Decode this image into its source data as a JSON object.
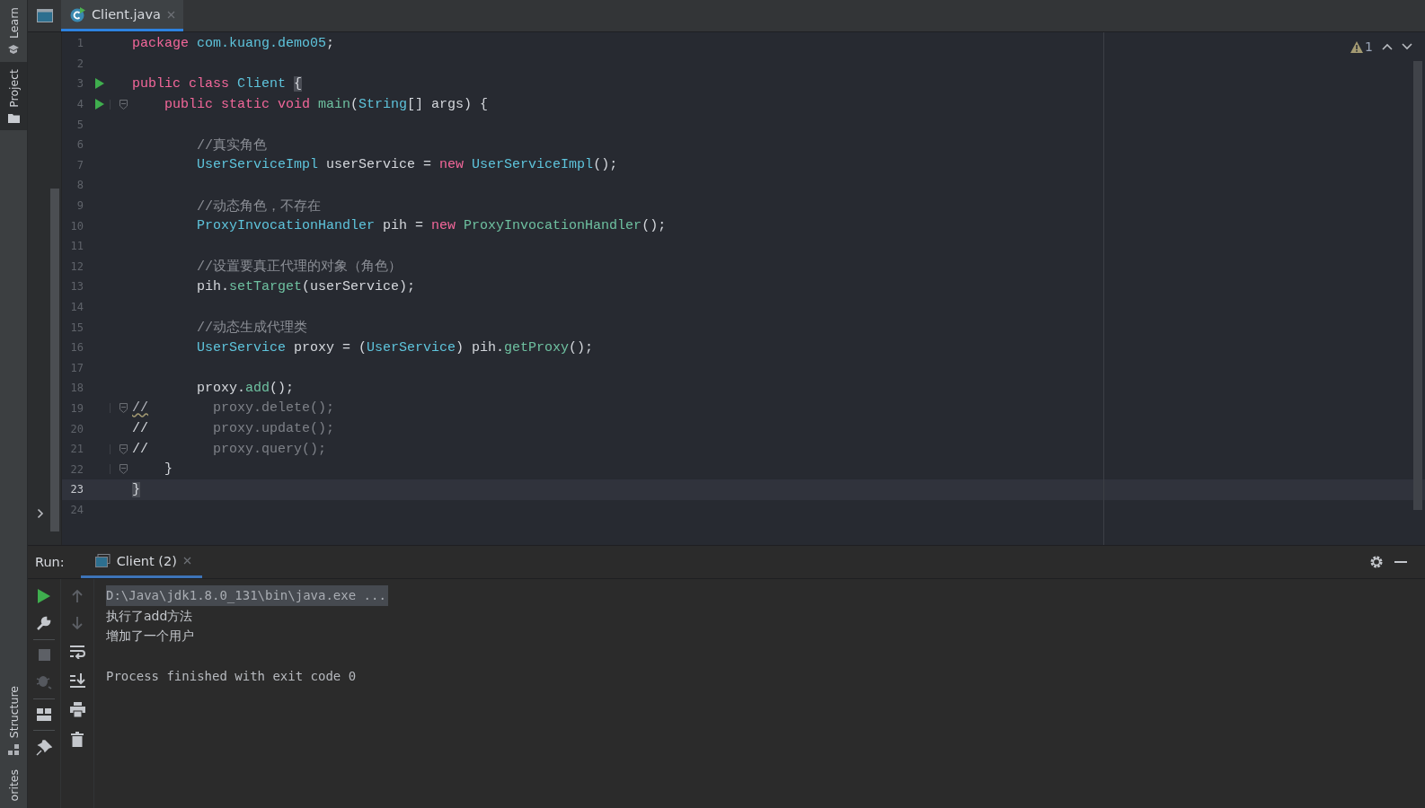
{
  "tool_strip": {
    "top": [
      "Learn",
      "Project"
    ],
    "bottom": [
      "Structure",
      "orites"
    ]
  },
  "editor_tabs": [
    {
      "label": "Client.java",
      "selected": true
    }
  ],
  "inspection": {
    "warnings": "1"
  },
  "code_lines": [
    {
      "number": "1",
      "run_marker": false,
      "fold": false,
      "current": false,
      "tokens": [
        {
          "text": "package ",
          "kind": "keyword"
        },
        {
          "text": "com.kuang.demo05",
          "kind": "type"
        },
        {
          "text": ";",
          "kind": "plain"
        }
      ]
    },
    {
      "number": "2",
      "run_marker": false,
      "fold": false,
      "current": false
    },
    {
      "number": "3",
      "run_marker": true,
      "fold": false,
      "current": false,
      "tokens": [
        {
          "text": "public class ",
          "kind": "keyword"
        },
        {
          "text": "Client ",
          "kind": "type"
        },
        {
          "text": "{",
          "kind": "brace"
        }
      ]
    },
    {
      "number": "4",
      "run_marker": true,
      "fold": true,
      "current": false,
      "tokens": [
        {
          "text": "    public static void ",
          "kind": "keyword"
        },
        {
          "text": "main",
          "kind": "method"
        },
        {
          "text": "(",
          "kind": "plain"
        },
        {
          "text": "String",
          "kind": "type"
        },
        {
          "text": "[] args) {",
          "kind": "plain"
        }
      ]
    },
    {
      "number": "5",
      "run_marker": false,
      "fold": false,
      "current": false
    },
    {
      "number": "6",
      "run_marker": false,
      "fold": false,
      "current": false,
      "tokens": [
        {
          "text": "        //真实角色",
          "kind": "comment"
        }
      ]
    },
    {
      "number": "7",
      "run_marker": false,
      "fold": false,
      "current": false,
      "tokens": [
        {
          "text": "        UserServiceImpl",
          "kind": "type"
        },
        {
          "text": " userService = ",
          "kind": "plain"
        },
        {
          "text": "new ",
          "kind": "keyword"
        },
        {
          "text": "UserServiceImpl",
          "kind": "type"
        },
        {
          "text": "();",
          "kind": "plain"
        }
      ]
    },
    {
      "number": "8",
      "run_marker": false,
      "fold": false,
      "current": false
    },
    {
      "number": "9",
      "run_marker": false,
      "fold": false,
      "current": false,
      "tokens": [
        {
          "text": "        //动态角色，不存在",
          "kind": "comment"
        }
      ]
    },
    {
      "number": "10",
      "run_marker": false,
      "fold": false,
      "current": false,
      "tokens": [
        {
          "text": "        ProxyInvocationHandler",
          "kind": "type"
        },
        {
          "text": " pih = ",
          "kind": "plain"
        },
        {
          "text": "new ",
          "kind": "keyword"
        },
        {
          "text": "ProxyInvocationHandler",
          "kind": "method"
        },
        {
          "text": "();",
          "kind": "plain"
        }
      ]
    },
    {
      "number": "11",
      "run_marker": false,
      "fold": false,
      "current": false
    },
    {
      "number": "12",
      "run_marker": false,
      "fold": false,
      "current": false,
      "tokens": [
        {
          "text": "        //设置要真正代理的对象（角色）",
          "kind": "comment"
        }
      ]
    },
    {
      "number": "13",
      "run_marker": false,
      "fold": false,
      "current": false,
      "tokens": [
        {
          "text": "        pih.",
          "kind": "plain"
        },
        {
          "text": "setTarget",
          "kind": "method"
        },
        {
          "text": "(userService);",
          "kind": "plain"
        }
      ]
    },
    {
      "number": "14",
      "run_marker": false,
      "fold": false,
      "current": false
    },
    {
      "number": "15",
      "run_marker": false,
      "fold": false,
      "current": false,
      "tokens": [
        {
          "text": "        //动态生成代理类",
          "kind": "comment"
        }
      ]
    },
    {
      "number": "16",
      "run_marker": false,
      "fold": false,
      "current": false,
      "tokens": [
        {
          "text": "        UserService",
          "kind": "type"
        },
        {
          "text": " proxy = (",
          "kind": "plain"
        },
        {
          "text": "UserService",
          "kind": "type"
        },
        {
          "text": ") pih.",
          "kind": "plain"
        },
        {
          "text": "getProxy",
          "kind": "method"
        },
        {
          "text": "();",
          "kind": "plain"
        }
      ]
    },
    {
      "number": "17",
      "run_marker": false,
      "fold": false,
      "current": false
    },
    {
      "number": "18",
      "run_marker": false,
      "fold": false,
      "current": false,
      "tokens": [
        {
          "text": "        proxy.",
          "kind": "plain"
        },
        {
          "text": "add",
          "kind": "method"
        },
        {
          "text": "();",
          "kind": "plain"
        }
      ]
    },
    {
      "number": "19",
      "run_marker": false,
      "fold": true,
      "current": false,
      "tokens": [
        {
          "text": "//",
          "kind": "warning"
        },
        {
          "text": "        proxy.delete();",
          "kind": "disabled"
        }
      ]
    },
    {
      "number": "20",
      "run_marker": false,
      "fold": false,
      "current": false,
      "tokens": [
        {
          "text": "//",
          "kind": "plain"
        },
        {
          "text": "        proxy.update();",
          "kind": "disabled"
        }
      ]
    },
    {
      "number": "21",
      "run_marker": false,
      "fold": true,
      "current": false,
      "tokens": [
        {
          "text": "//",
          "kind": "plain"
        },
        {
          "text": "        proxy.query();",
          "kind": "disabled"
        }
      ]
    },
    {
      "number": "22",
      "run_marker": false,
      "fold": true,
      "current": false,
      "tokens": [
        {
          "text": "    }",
          "kind": "plain"
        }
      ]
    },
    {
      "number": "23",
      "run_marker": false,
      "fold": false,
      "current": true,
      "tokens": [
        {
          "text": "}",
          "kind": "brace"
        }
      ]
    },
    {
      "number": "24",
      "run_marker": false,
      "fold": false,
      "current": false
    }
  ],
  "run_panel": {
    "label": "Run:",
    "tabs": [
      {
        "label": "Client (2)",
        "selected": true
      }
    ],
    "console": [
      {
        "text": "D:\\Java\\jdk1.8.0_131\\bin\\java.exe ...",
        "kind": "command"
      },
      {
        "text": "执行了add方法",
        "kind": "output"
      },
      {
        "text": "增加了一个用户",
        "kind": "output"
      },
      {
        "text": "Process finished with exit code 0",
        "kind": "exit"
      }
    ]
  }
}
